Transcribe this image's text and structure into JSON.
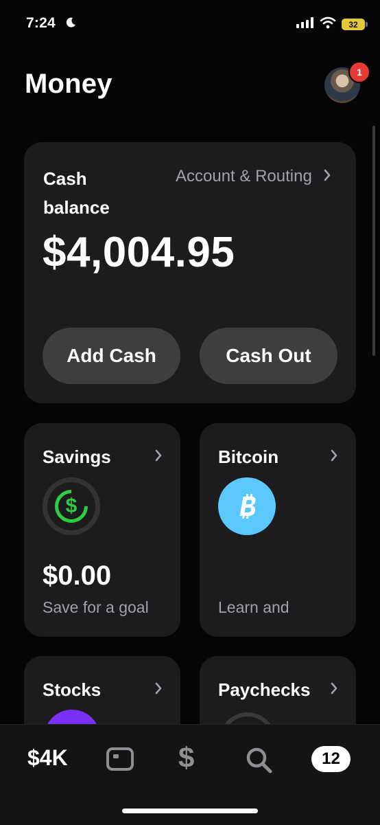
{
  "status_bar": {
    "time": "7:24",
    "battery": "32"
  },
  "header": {
    "title": "Money",
    "notification_count": "1"
  },
  "cash_card": {
    "label": "Cash balance",
    "account_link": "Account & Routing",
    "balance": "$4,004.95",
    "add_cash": "Add Cash",
    "cash_out": "Cash Out"
  },
  "tiles": {
    "savings": {
      "title": "Savings",
      "amount": "$0.00",
      "subtitle": "Save for a goal"
    },
    "bitcoin": {
      "title": "Bitcoin",
      "subtitle": "Learn and"
    },
    "stocks": {
      "title": "Stocks"
    },
    "paychecks": {
      "title": "Paychecks"
    }
  },
  "tab_bar": {
    "balance": "$4K",
    "dollar": "$",
    "activity_count": "12"
  },
  "colors": {
    "savings_green": "#2ecc40",
    "bitcoin_blue": "#5ac8fa",
    "stocks_purple": "#7b2ff7",
    "notif_red": "#e53935"
  },
  "icons": [
    "moon-icon",
    "signal-icon",
    "wifi-icon",
    "battery-icon",
    "chevron-right-icon",
    "savings-dollar-icon",
    "bitcoin-icon",
    "card-icon",
    "dollar-icon",
    "search-icon"
  ]
}
